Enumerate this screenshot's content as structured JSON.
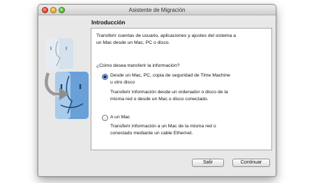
{
  "window": {
    "title": "Asistente de Migración",
    "controls": [
      "close-icon",
      "minimize-icon",
      "zoom-icon"
    ]
  },
  "panel": {
    "heading": "Introducción",
    "intro": [
      "Transferir cuentas de usuario, aplicaciones y ajustes del sistema a",
      "un Mac desde un Mac, PC o disco."
    ],
    "question": "¿Cómo desea transferir la información?",
    "options": [
      {
        "label": [
          "Desde un Mac, PC, copia de seguridad de Time Machine",
          "u otro disco"
        ],
        "selected": true,
        "description": [
          "Transferir información desde un ordenador o disco de la",
          "misma red o desde un Mac o disco conectado."
        ]
      },
      {
        "label": [
          "A un Mac"
        ],
        "selected": false,
        "description": [
          "Transferir información a un Mac de la misma red o",
          "conectado mediante un cable Ethernet."
        ]
      }
    ]
  },
  "buttons": {
    "quit": "Salir",
    "continue": "Continuar"
  },
  "colors": {
    "finder_blue": "#6aa0d8",
    "finder_light": "#c6ddf2"
  },
  "icons": [
    "finder-face-icon",
    "migration-arrow-icon"
  ]
}
